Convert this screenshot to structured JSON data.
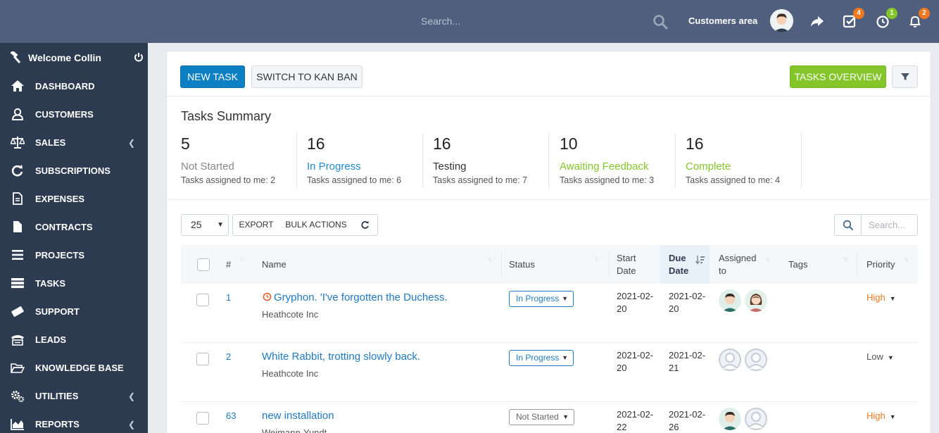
{
  "topbar": {
    "search_placeholder": "Search...",
    "customers_area": "Customers area",
    "badges": {
      "tasks": "4",
      "timers": "1",
      "notifications": "2"
    },
    "colors": {
      "bg": "#4f5f7d",
      "badge_orange": "#f0781e",
      "badge_green": "#84c529"
    }
  },
  "sidebar": {
    "welcome": "Welcome Collin",
    "items": [
      {
        "label": "DASHBOARD",
        "icon": "home-icon",
        "chevron": false
      },
      {
        "label": "CUSTOMERS",
        "icon": "user-icon",
        "chevron": false
      },
      {
        "label": "SALES",
        "icon": "balance-scale-icon",
        "chevron": true
      },
      {
        "label": "SUBSCRIPTIONS",
        "icon": "refresh-icon",
        "chevron": false
      },
      {
        "label": "EXPENSES",
        "icon": "file-text-icon",
        "chevron": false
      },
      {
        "label": "CONTRACTS",
        "icon": "file-icon",
        "chevron": false
      },
      {
        "label": "PROJECTS",
        "icon": "bars-icon",
        "chevron": false
      },
      {
        "label": "TASKS",
        "icon": "tasks-icon",
        "chevron": false
      },
      {
        "label": "SUPPORT",
        "icon": "ticket-icon",
        "chevron": false
      },
      {
        "label": "LEADS",
        "icon": "tty-icon",
        "chevron": false
      },
      {
        "label": "KNOWLEDGE BASE",
        "icon": "folder-open-icon",
        "chevron": false
      },
      {
        "label": "UTILITIES",
        "icon": "cogs-icon",
        "chevron": true
      },
      {
        "label": "REPORTS",
        "icon": "area-chart-icon",
        "chevron": true
      }
    ]
  },
  "toolbar": {
    "new_task": "NEW TASK",
    "switch_kanban": "SWITCH TO KAN BAN",
    "tasks_overview": "TASKS OVERVIEW"
  },
  "summary": {
    "title": "Tasks Summary",
    "stats": [
      {
        "count": "5",
        "name": "Not Started",
        "assigned": "Tasks assigned to me: 2",
        "color": "#888888"
      },
      {
        "count": "16",
        "name": "In Progress",
        "assigned": "Tasks assigned to me: 6",
        "color": "#1f8bd1"
      },
      {
        "count": "16",
        "name": "Testing",
        "assigned": "Tasks assigned to me: 7",
        "color": "#333333"
      },
      {
        "count": "10",
        "name": "Awaiting Feedback",
        "assigned": "Tasks assigned to me: 3",
        "color": "#84c529"
      },
      {
        "count": "16",
        "name": "Complete",
        "assigned": "Tasks assigned to me: 4",
        "color": "#84c529"
      }
    ]
  },
  "table_controls": {
    "page_length": "25",
    "export": "EXPORT",
    "bulk_actions": "BULK ACTIONS",
    "search_placeholder": "Search..."
  },
  "table": {
    "headers": {
      "id": "#",
      "name": "Name",
      "status": "Status",
      "start_date_1": "Start",
      "start_date_2": "Date",
      "due_date_1": "Due",
      "due_date_2": "Date",
      "assigned_1": "Assigned",
      "assigned_2": "to",
      "tags": "Tags",
      "priority": "Priority"
    },
    "rows": [
      {
        "id": "1",
        "name": "Gryphon. 'I've forgotten the Duchess.",
        "company": "Heathcote Inc",
        "status": "In Progress",
        "start_1": "2021-02-",
        "start_2": "20",
        "due_1": "2021-02-",
        "due_2": "20",
        "priority": "High",
        "priority_color": "#f0781e",
        "overdue": true
      },
      {
        "id": "2",
        "name": "White Rabbit, trotting slowly back.",
        "company": "Heathcote Inc",
        "status": "In Progress",
        "start_1": "2021-02-",
        "start_2": "20",
        "due_1": "2021-02-",
        "due_2": "21",
        "priority": "Low",
        "priority_color": "#555555",
        "overdue": false
      },
      {
        "id": "63",
        "name": "new installation",
        "company": "Weimann-Yundt",
        "status": "Not Started",
        "start_1": "2021-02-",
        "start_2": "22",
        "due_1": "2021-02-",
        "due_2": "26",
        "priority": "High",
        "priority_color": "#f0781e",
        "overdue": false
      }
    ]
  }
}
